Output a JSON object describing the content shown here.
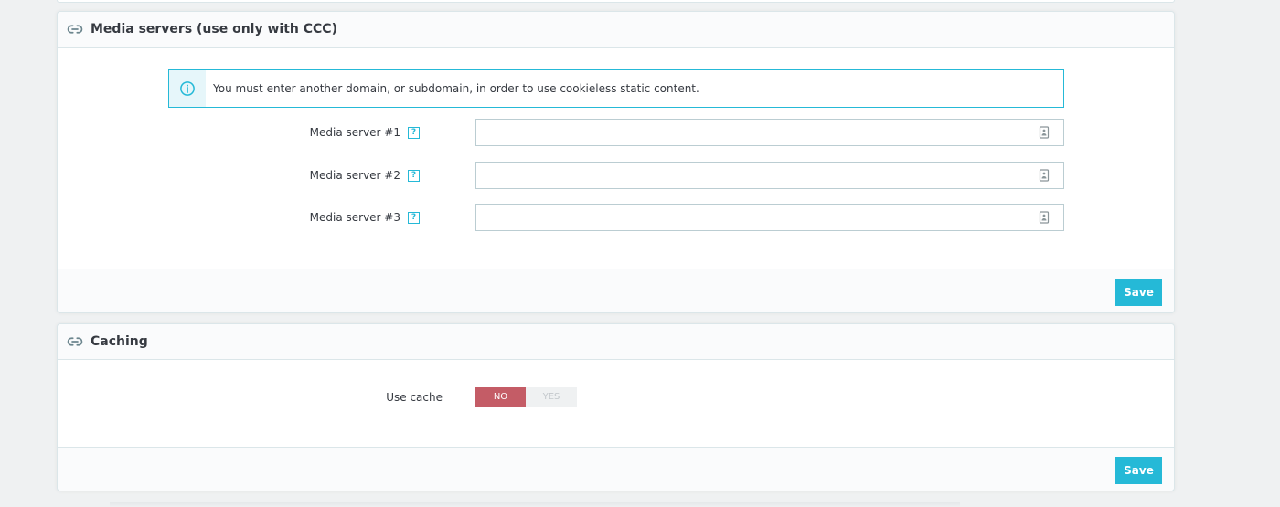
{
  "media_servers": {
    "title": "Media servers (use only with CCC)",
    "alert_text": "You must enter another domain, or subdomain, in order to use cookieless static content.",
    "fields": [
      {
        "label": "Media server #1",
        "value": "",
        "help": "?"
      },
      {
        "label": "Media server #2",
        "value": "",
        "help": "?"
      },
      {
        "label": "Media server #3",
        "value": "",
        "help": "?"
      }
    ],
    "save_label": "Save"
  },
  "caching": {
    "title": "Caching",
    "use_cache_label": "Use cache",
    "switch": {
      "no_label": "NO",
      "yes_label": "YES",
      "selected": "NO"
    },
    "save_label": "Save"
  },
  "icons": {
    "panel_icon": "link-icon",
    "alert_icon": "info-icon",
    "field_icon": "contact-card-icon"
  },
  "colors": {
    "accent": "#25b9d7",
    "danger": "#c45c66",
    "border": "#dbe6e9",
    "background": "#eff1f2"
  }
}
